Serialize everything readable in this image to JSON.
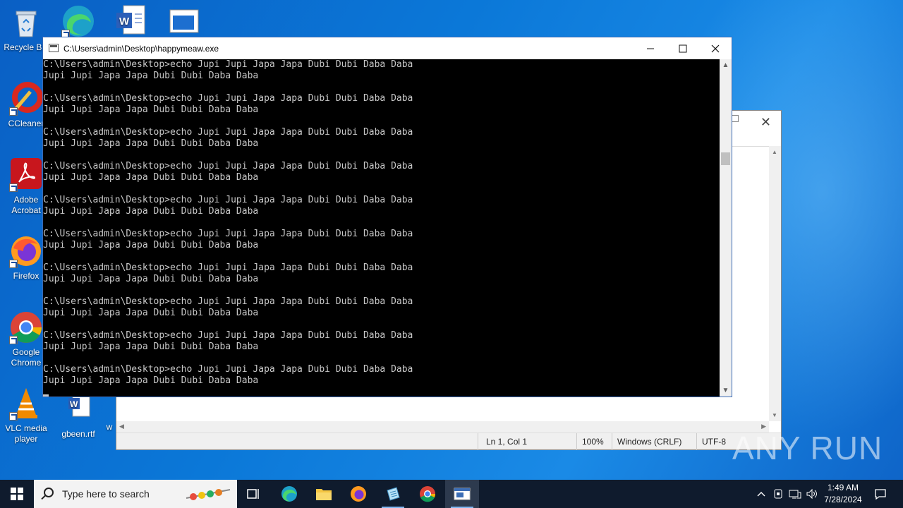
{
  "desktop": {
    "icons": [
      {
        "label": "Recycle Bin"
      },
      {
        "label": "CCleaner"
      },
      {
        "label": "Adobe Acrobat"
      },
      {
        "label": "Firefox"
      },
      {
        "label": "Google Chrome"
      },
      {
        "label": "VLC media player"
      },
      {
        "label": "gbeen.rtf"
      },
      {
        "label": "w"
      }
    ]
  },
  "notepad": {
    "status": {
      "position": "Ln 1, Col 1",
      "zoom": "100%",
      "line_ending": "Windows (CRLF)",
      "encoding": "UTF-8"
    }
  },
  "console": {
    "title": "C:\\Users\\admin\\Desktop\\happymeaw.exe",
    "lines": [
      "C:\\Users\\admin\\Desktop>echo Jupi Jupi Japa Japa Dubi Dubi Daba Daba",
      "Jupi Jupi Japa Japa Dubi Dubi Daba Daba",
      "",
      "C:\\Users\\admin\\Desktop>echo Jupi Jupi Japa Japa Dubi Dubi Daba Daba",
      "Jupi Jupi Japa Japa Dubi Dubi Daba Daba",
      "",
      "C:\\Users\\admin\\Desktop>echo Jupi Jupi Japa Japa Dubi Dubi Daba Daba",
      "Jupi Jupi Japa Japa Dubi Dubi Daba Daba",
      "",
      "C:\\Users\\admin\\Desktop>echo Jupi Jupi Japa Japa Dubi Dubi Daba Daba",
      "Jupi Jupi Japa Japa Dubi Dubi Daba Daba",
      "",
      "C:\\Users\\admin\\Desktop>echo Jupi Jupi Japa Japa Dubi Dubi Daba Daba",
      "Jupi Jupi Japa Japa Dubi Dubi Daba Daba",
      "",
      "C:\\Users\\admin\\Desktop>echo Jupi Jupi Japa Japa Dubi Dubi Daba Daba",
      "Jupi Jupi Japa Japa Dubi Dubi Daba Daba",
      "",
      "C:\\Users\\admin\\Desktop>echo Jupi Jupi Japa Japa Dubi Dubi Daba Daba",
      "Jupi Jupi Japa Japa Dubi Dubi Daba Daba",
      "",
      "C:\\Users\\admin\\Desktop>echo Jupi Jupi Japa Japa Dubi Dubi Daba Daba",
      "Jupi Jupi Japa Japa Dubi Dubi Daba Daba",
      "",
      "C:\\Users\\admin\\Desktop>echo Jupi Jupi Japa Japa Dubi Dubi Daba Daba",
      "Jupi Jupi Japa Japa Dubi Dubi Daba Daba",
      "",
      "C:\\Users\\admin\\Desktop>echo Jupi Jupi Japa Japa Dubi Dubi Daba Daba",
      "Jupi Jupi Japa Japa Dubi Dubi Daba Daba"
    ]
  },
  "taskbar": {
    "search_placeholder": "Type here to search",
    "clock_time": "1:49 AM",
    "clock_date": "7/28/2024"
  },
  "watermark": "ANY RUN"
}
